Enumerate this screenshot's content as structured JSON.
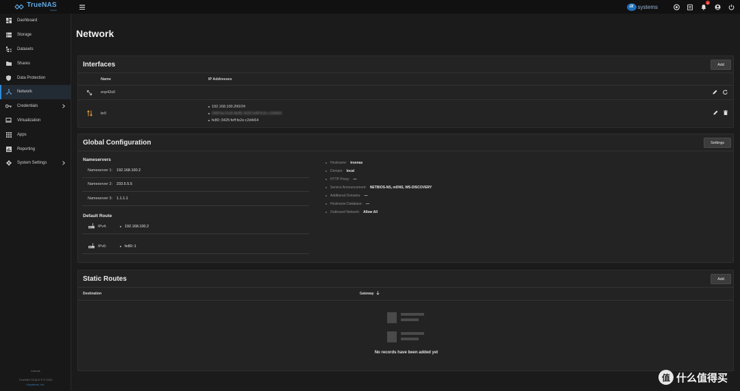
{
  "app": {
    "brand": "TrueNAS",
    "brand_sub": "SCALE"
  },
  "topbar": {
    "ix_badge": "iX",
    "ix_text": "systems",
    "notification_count": "1"
  },
  "sidebar": {
    "items": [
      {
        "label": "Dashboard",
        "icon": "dashboard-icon"
      },
      {
        "label": "Storage",
        "icon": "storage-icon"
      },
      {
        "label": "Datasets",
        "icon": "datasets-icon"
      },
      {
        "label": "Shares",
        "icon": "folder-icon"
      },
      {
        "label": "Data Protection",
        "icon": "shield-icon"
      },
      {
        "label": "Network",
        "icon": "network-icon"
      },
      {
        "label": "Credentials",
        "icon": "key-icon"
      },
      {
        "label": "Virtualization",
        "icon": "laptop-icon"
      },
      {
        "label": "Apps",
        "icon": "apps-grid-icon"
      },
      {
        "label": "Reporting",
        "icon": "chart-icon"
      },
      {
        "label": "System Settings",
        "icon": "gear-icon"
      }
    ],
    "active": "Network",
    "footer": {
      "hostname": "truenas",
      "version": "TrueNAS SCALE ® © 2024",
      "company": "iXsystems, Inc."
    }
  },
  "page": {
    "title": "Network"
  },
  "interfaces": {
    "title": "Interfaces",
    "add_label": "Add",
    "columns": {
      "name": "Name",
      "ip": "IP Addresses"
    },
    "rows": [
      {
        "name": "enp42s0",
        "ips": []
      },
      {
        "name": "br0",
        "ips": [
          "192.168.100.200/24",
          "240f:6a:f1e8:4b45:1625:5eff:fe2e:c2d4/64",
          "fe80::3425:feff:fe2e:c2d4/64"
        ]
      }
    ]
  },
  "global_config": {
    "title": "Global Configuration",
    "settings_label": "Settings",
    "nameservers_title": "Nameservers",
    "nameservers": [
      {
        "label": "Nameserver 1:",
        "value": "192.168.100.2"
      },
      {
        "label": "Nameserver 2:",
        "value": "233.5.5.5"
      },
      {
        "label": "Nameserver 3:",
        "value": "1.1.1.1"
      }
    ],
    "default_route_title": "Default Route",
    "routes": [
      {
        "label": "IPv4:",
        "value": "192.168.100.2"
      },
      {
        "label": "IPv6:",
        "value": "fe80::1"
      }
    ],
    "details": [
      {
        "key": "Hostname:",
        "value": "truenas"
      },
      {
        "key": "Domain:",
        "value": "local"
      },
      {
        "key": "HTTP Proxy:",
        "value": "—"
      },
      {
        "key": "Service Announcement:",
        "value": "NETBIOS-NS, mDNS, WS-DISCOVERY"
      },
      {
        "key": "Additional Domains:",
        "value": "—"
      },
      {
        "key": "Hostname Database:",
        "value": "—"
      },
      {
        "key": "Outbound Network:",
        "value": "Allow All"
      }
    ]
  },
  "static_routes": {
    "title": "Static Routes",
    "add_label": "Add",
    "columns": {
      "destination": "Destination",
      "gateway": "Gateway"
    },
    "empty_text": "No records have been added yet"
  },
  "watermark": {
    "badge": "值",
    "text": "什么值得买"
  },
  "colors": {
    "accent": "#2f8ad6",
    "brand": "#5fa9e6",
    "background": "#1b1b1b",
    "card": "#232323"
  }
}
